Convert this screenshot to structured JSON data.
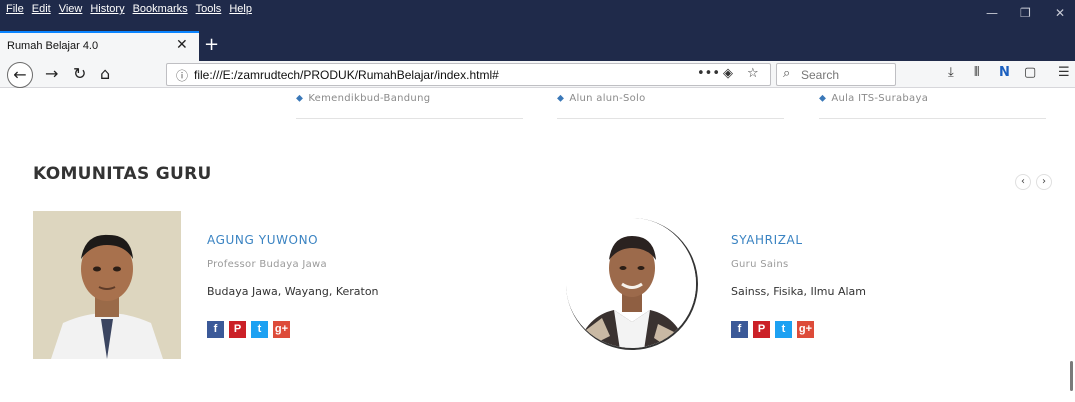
{
  "browser": {
    "menu": [
      "File",
      "Edit",
      "View",
      "History",
      "Bookmarks",
      "Tools",
      "Help"
    ],
    "tab_title": "Rumah Belajar 4.0",
    "url": "file:///E:/zamrudtech/PRODUK/RumahBelajar/index.html#",
    "search_placeholder": "Search"
  },
  "locations": [
    "Kemendikbud-Bandung",
    "Alun alun-Solo",
    "Aula ITS-Surabaya"
  ],
  "section": {
    "title": "KOMUNITAS GURU"
  },
  "teachers": [
    {
      "name": "AGUNG YUWONO",
      "role": "Professor Budaya Jawa",
      "desc": "Budaya Jawa, Wayang, Keraton"
    },
    {
      "name": "SYAHRIZAL",
      "role": "Guru Sains",
      "desc": "Sainss, Fisika, Ilmu Alam"
    }
  ],
  "social": {
    "facebook": {
      "glyph": "f",
      "color": "#3b5998"
    },
    "pinterest": {
      "glyph": "P",
      "color": "#cb2027"
    },
    "twitter": {
      "glyph": "t",
      "color": "#1da1f2"
    },
    "googleplus": {
      "glyph": "g+",
      "color": "#dd4b39"
    }
  }
}
